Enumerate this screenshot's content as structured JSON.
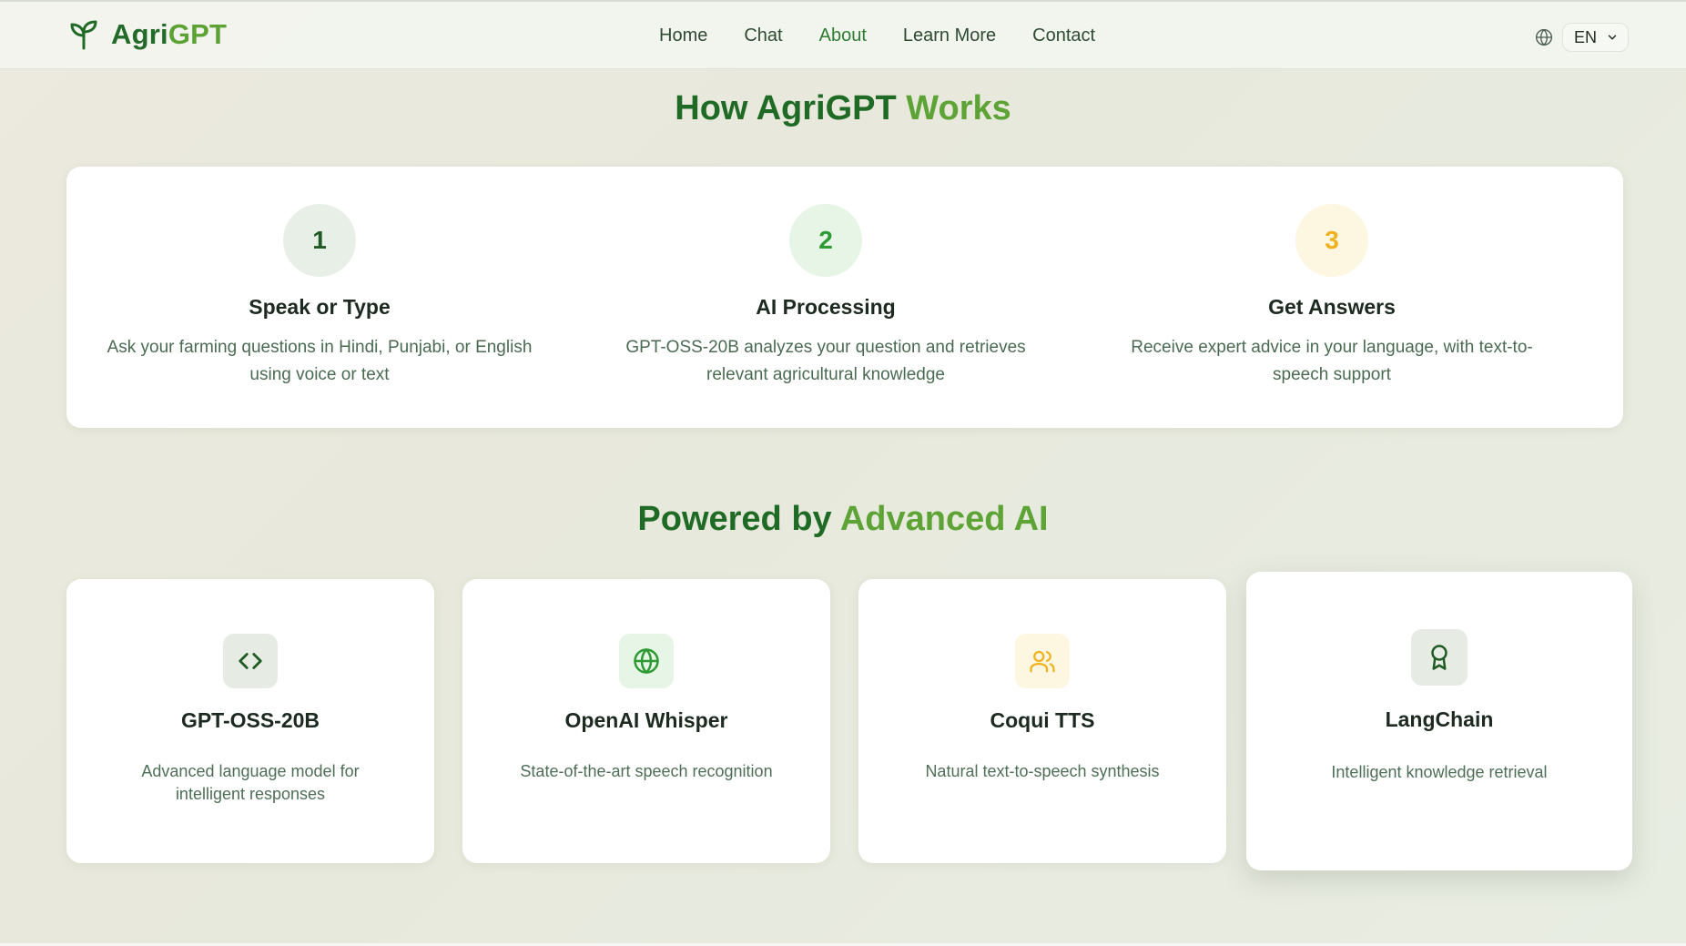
{
  "nav": {
    "brand": {
      "part1": "Agri",
      "part2": "GPT"
    },
    "links": [
      {
        "label": "Home",
        "active": false
      },
      {
        "label": "Chat",
        "active": false
      },
      {
        "label": "About",
        "active": true
      },
      {
        "label": "Learn More",
        "active": false
      },
      {
        "label": "Contact",
        "active": false
      }
    ],
    "language": "EN"
  },
  "how_section": {
    "title_part1": "How AgriGPT ",
    "title_part2": "Works",
    "steps": [
      {
        "number": "1",
        "title": "Speak or Type",
        "description": "Ask your farming questions in Hindi, Punjabi, or English using voice or text"
      },
      {
        "number": "2",
        "title": "AI Processing",
        "description": "GPT-OSS-20B analyzes your question and retrieves relevant agricultural knowledge"
      },
      {
        "number": "3",
        "title": "Get Answers",
        "description": "Receive expert advice in your language, with text-to-speech support"
      }
    ]
  },
  "powered_section": {
    "title_part1": "Powered by ",
    "title_part2": "Advanced AI",
    "cards": [
      {
        "icon": "code-icon",
        "title": "GPT-OSS-20B",
        "description": "Advanced language model for intelligent responses"
      },
      {
        "icon": "globe-icon",
        "title": "OpenAI Whisper",
        "description": "State-of-the-art speech recognition"
      },
      {
        "icon": "users-icon",
        "title": "Coqui TTS",
        "description": "Natural text-to-speech synthesis"
      },
      {
        "icon": "award-icon",
        "title": "LangChain",
        "description": "Intelligent knowledge retrieval"
      }
    ]
  },
  "colors": {
    "brand_dark": "#1f6b26",
    "brand_light": "#5ea336",
    "step1_bg": "#e8efe6",
    "step2_bg": "#e6f5e6",
    "step3_bg": "#fdf6e1",
    "step3_fg": "#f0b21c"
  }
}
